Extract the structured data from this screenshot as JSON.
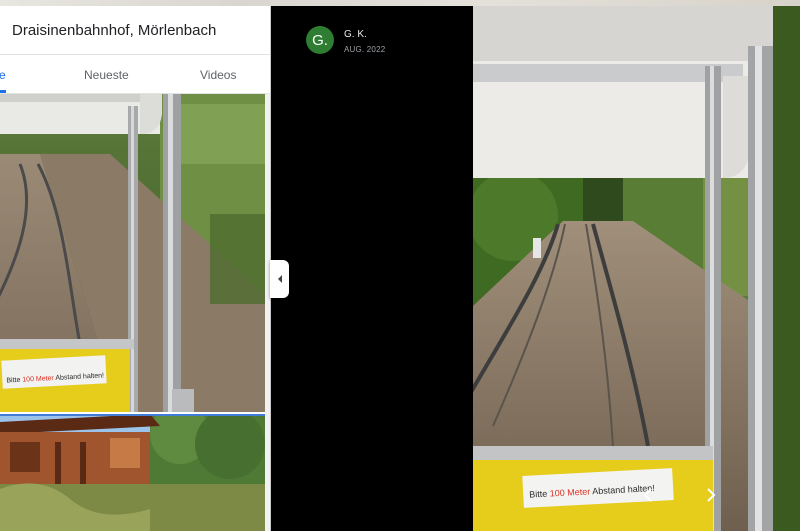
{
  "place": {
    "title": "Draisinenbahnhof, Mörlenbach"
  },
  "tabs": [
    {
      "label": "e",
      "active": true
    },
    {
      "label": "Neueste",
      "active": false
    },
    {
      "label": "Videos",
      "active": false
    }
  ],
  "photos": {
    "sign_text_pre": "Bitte ",
    "sign_text_red": "100 Meter",
    "sign_text_post": " Abstand halten!"
  },
  "viewer": {
    "avatar_letter": "G.",
    "author": "G. K.",
    "date": "AUG. 2022",
    "avatar_color": "#2e7d32"
  },
  "icons": {
    "collapse": "chevron-left-icon",
    "prev": "chevron-left-icon",
    "next": "chevron-right-icon"
  },
  "colors": {
    "accent": "#1a73e8",
    "sign_yellow": "#e8d21a",
    "sign_red": "#d93025"
  }
}
